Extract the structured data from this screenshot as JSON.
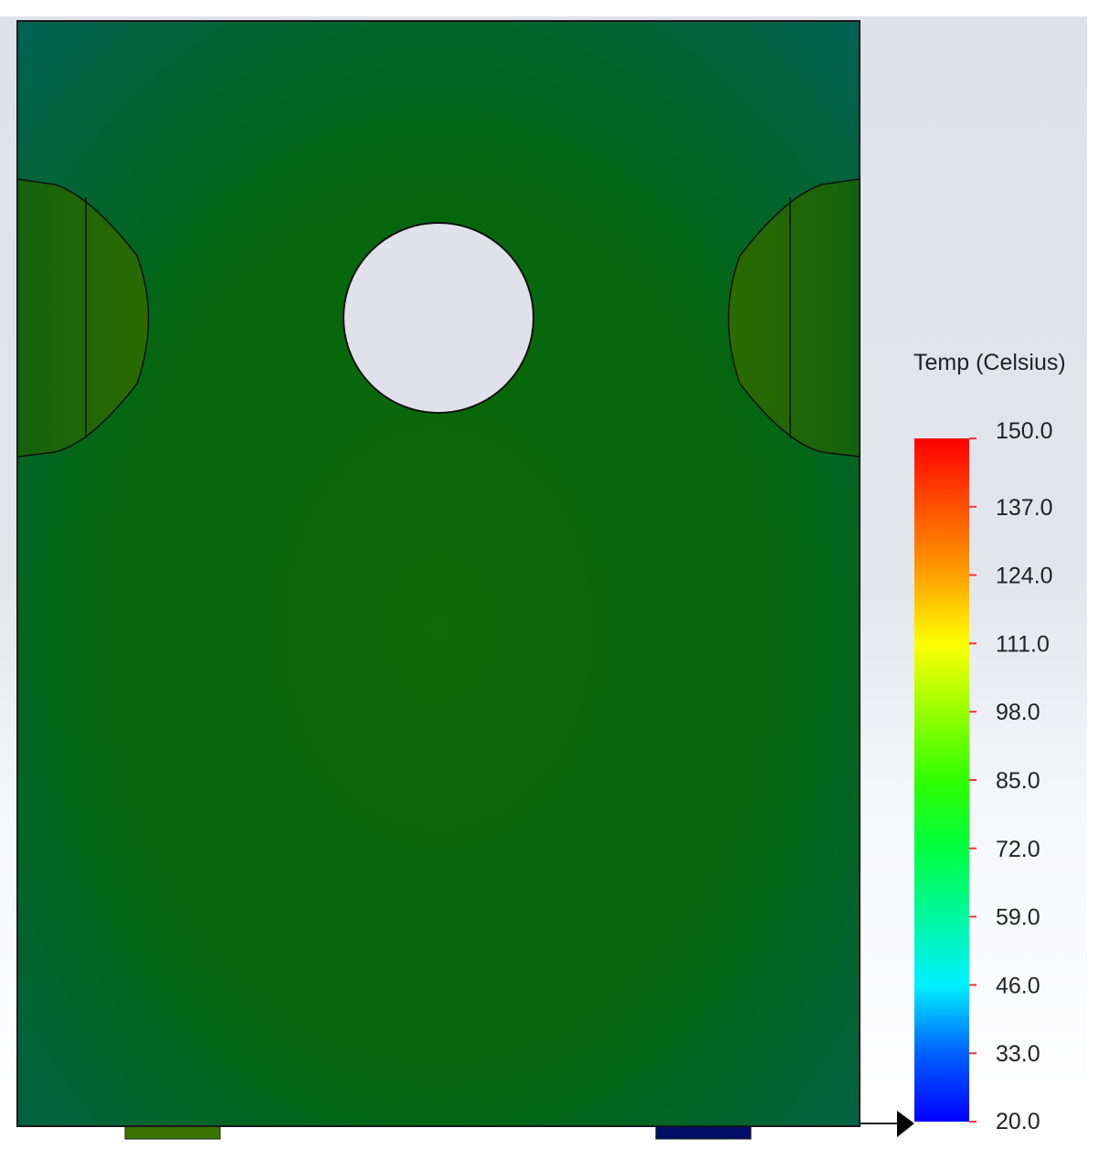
{
  "legend": {
    "title": "Temp (Celsius)",
    "min": 20.0,
    "max": 150.0,
    "ticks": [
      "150.0",
      "137.0",
      "124.0",
      "111.0",
      "98.0",
      "85.0",
      "72.0",
      "59.0",
      "46.0",
      "33.0",
      "20.0"
    ]
  },
  "colors": {
    "part_fill": "#0a6410",
    "cutout_fill": "#2a6a06",
    "tab_left": "#3a7500",
    "tab_right": "#000e66",
    "tick": "#ff3030"
  }
}
